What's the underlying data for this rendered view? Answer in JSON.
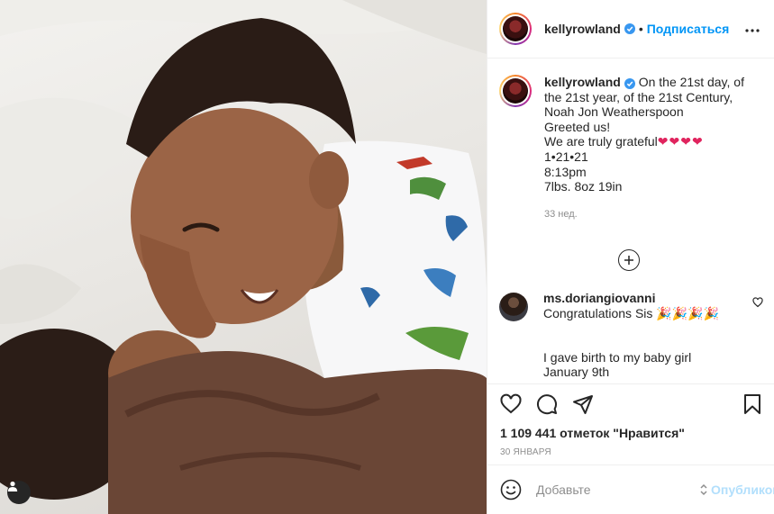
{
  "account": {
    "username": "kellyrowland",
    "follow_label": "Подписаться",
    "separator": "•"
  },
  "caption": {
    "lines": [
      "On the 21st day, of",
      "the 21st year, of the 21st Century,",
      "Noah Jon Weatherspoon",
      "Greeted us!",
      "We are truly grateful",
      "1•21•21",
      "8:13pm",
      "7lbs. 8oz 19in"
    ],
    "hearts": "❤❤❤❤",
    "time_ago": "33 нед."
  },
  "comment": {
    "username": "ms.doriangiovanni",
    "lines": [
      "Congratulations Sis 🎉🎉🎉🎉",
      "",
      "I gave birth to my baby girl",
      "January 9th"
    ]
  },
  "stats": {
    "likes": "1 109 441 отметок \"Нравится\"",
    "date": "30 ЯНВАРЯ"
  },
  "composer": {
    "placeholder": "Добавьте",
    "publish_label": "Опубликовать"
  },
  "icons": {
    "verified": "verified-badge-icon",
    "more": "more-options-icon",
    "load_more": "plus-circle-icon",
    "like": "heart-outline-icon",
    "comment": "comment-bubble-icon",
    "share": "paper-plane-icon",
    "save": "bookmark-icon",
    "emoji": "smiley-icon",
    "tag": "user-tag-icon"
  },
  "colors": {
    "accent": "#0095f6",
    "verified": "#3897f0",
    "heart": "#e0245e",
    "muted": "#8e8e8e",
    "publish_disabled": "#b2dffc"
  }
}
